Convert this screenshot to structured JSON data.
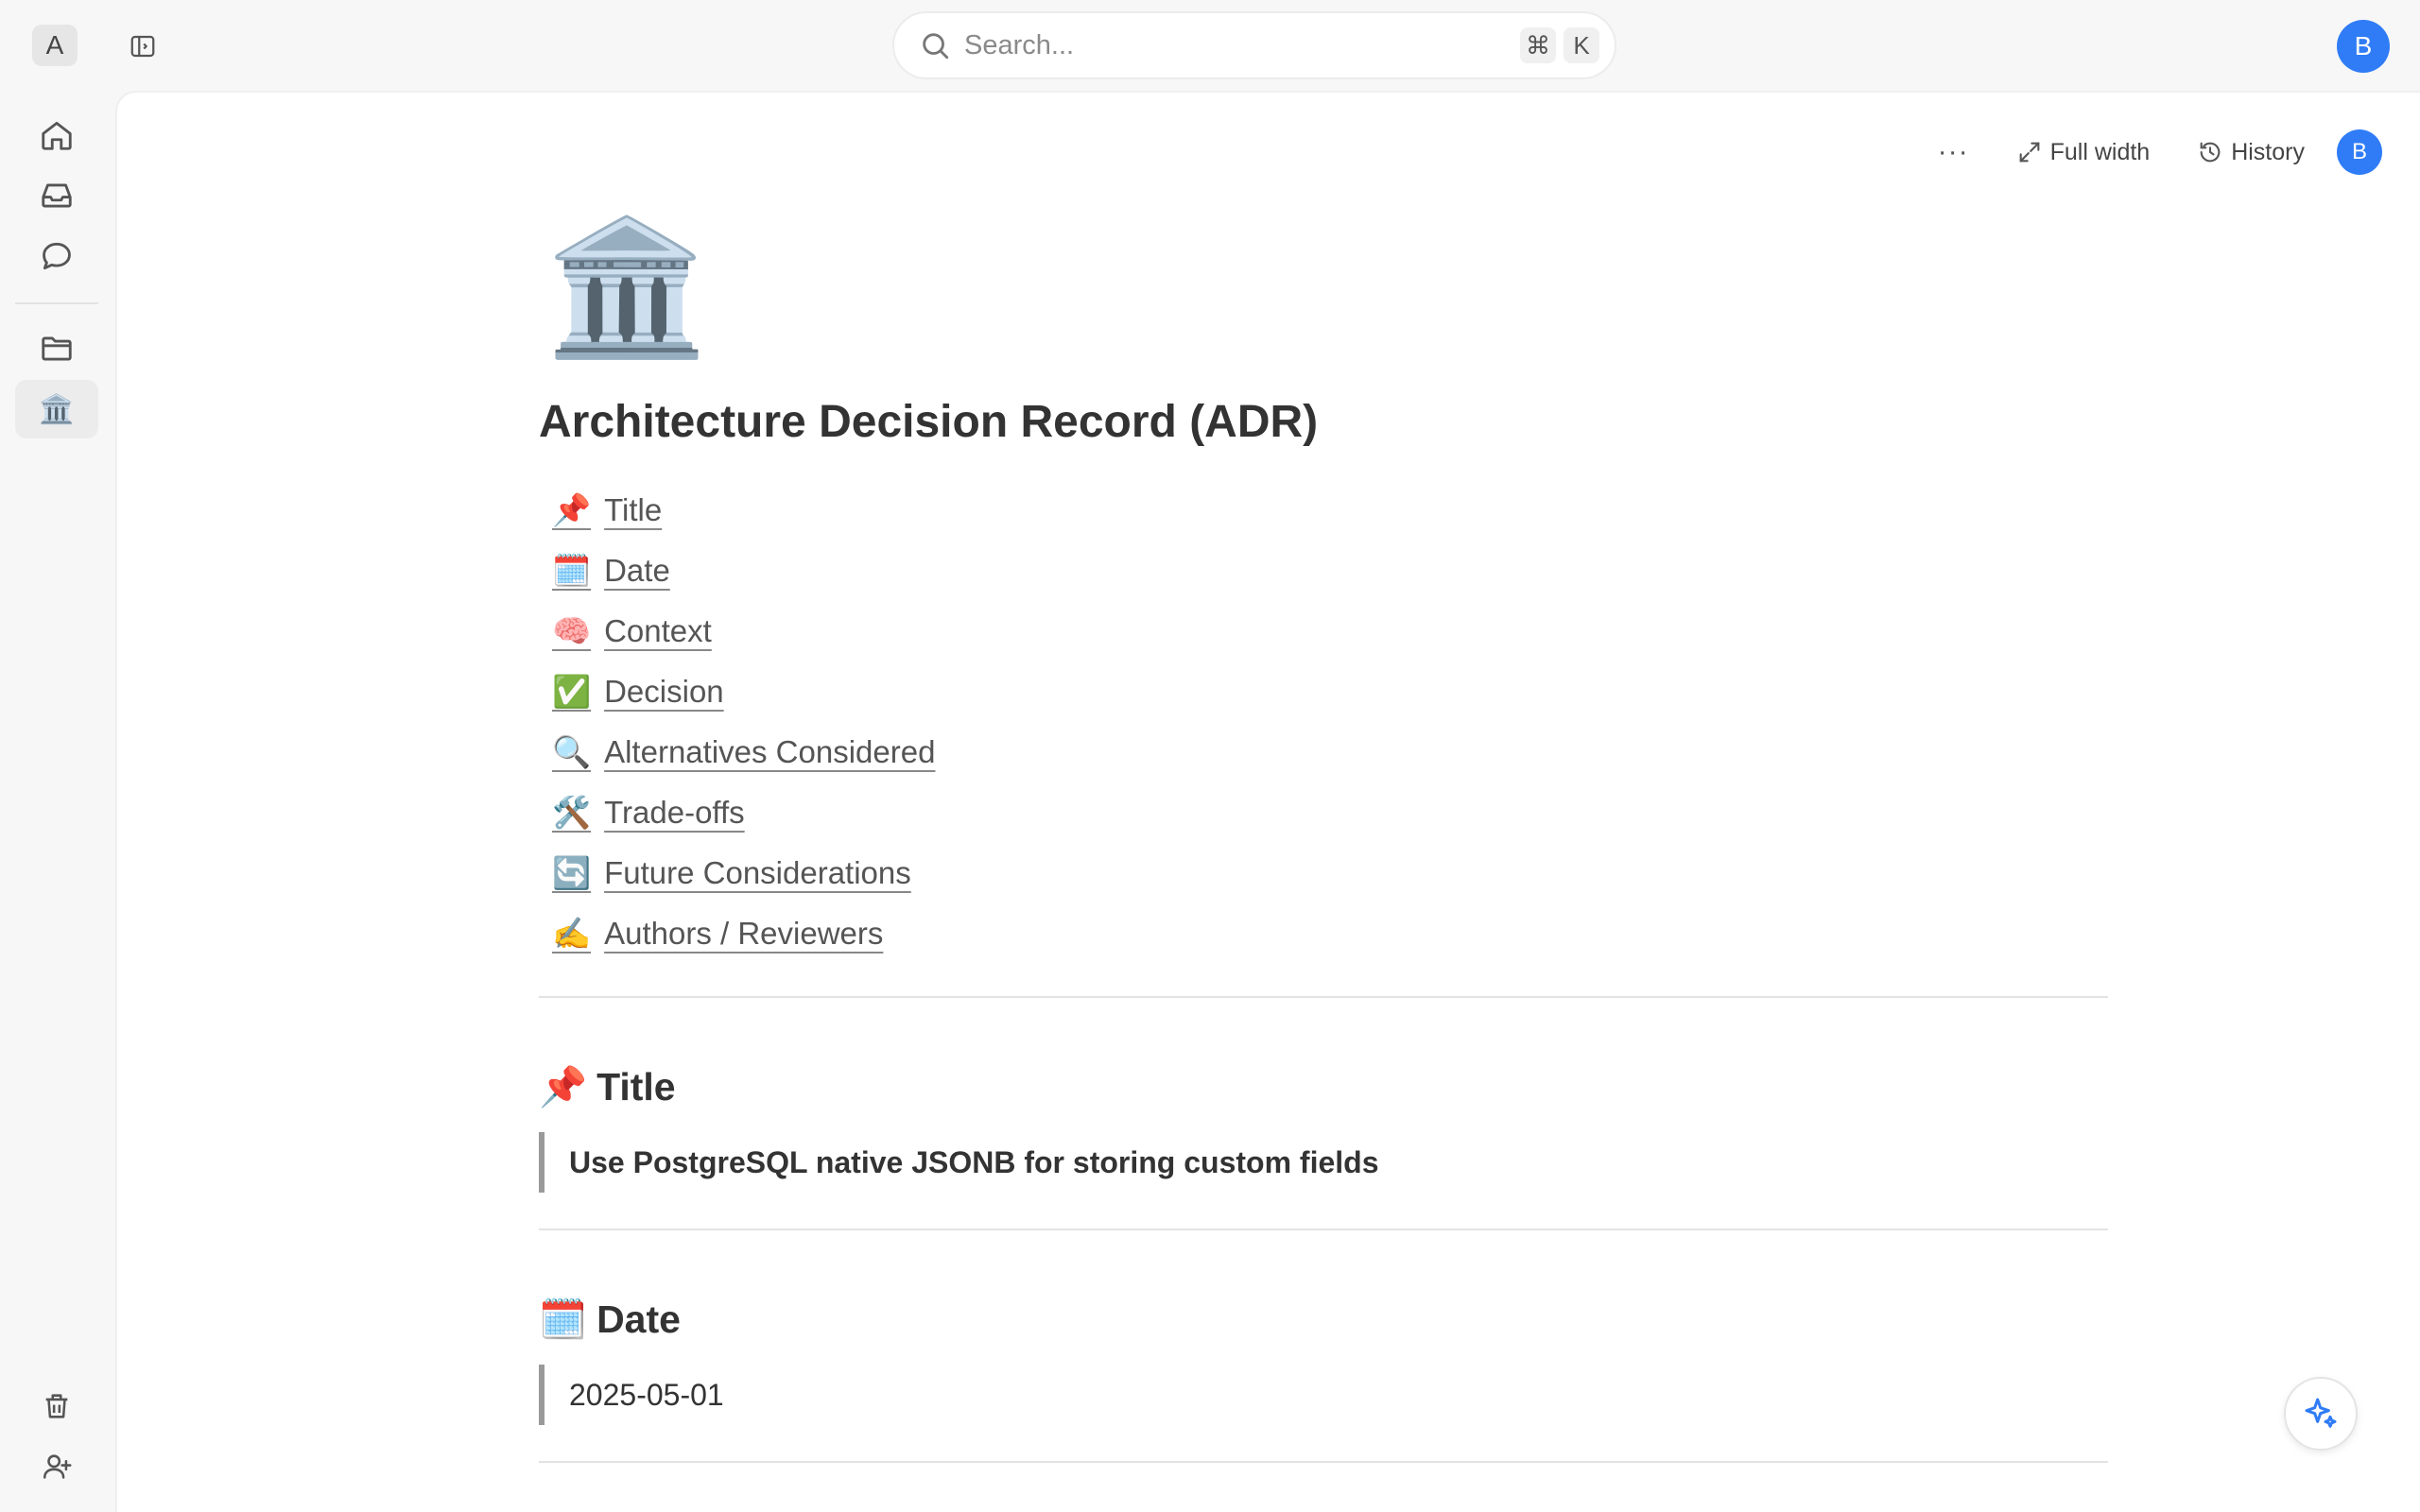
{
  "workspace": {
    "initial": "A"
  },
  "search": {
    "placeholder": "Search...",
    "shortcut_cmd": "⌘",
    "shortcut_key": "K"
  },
  "user": {
    "initial": "B",
    "accent": "#2f7cf6"
  },
  "rail": {
    "items": [
      "home-icon",
      "inbox-icon",
      "chat-icon",
      "folder-icon",
      "page-adr"
    ],
    "active_page_emoji": "🏛️",
    "bottom": [
      "trash-icon",
      "invite-user-icon"
    ]
  },
  "toolbar": {
    "more": "···",
    "full_width": "Full width",
    "history": "History"
  },
  "doc": {
    "emoji": "🏛️",
    "title": "Architecture Decision Record (ADR)",
    "toc": [
      {
        "emoji": "📌",
        "label": "Title"
      },
      {
        "emoji": "🗓️",
        "label": "Date"
      },
      {
        "emoji": "🧠",
        "label": "Context"
      },
      {
        "emoji": "✅",
        "label": "Decision"
      },
      {
        "emoji": "🔍",
        "label": "Alternatives Considered"
      },
      {
        "emoji": "🛠️",
        "label": "Trade-offs"
      },
      {
        "emoji": "🔄",
        "label": "Future Considerations"
      },
      {
        "emoji": "✍️",
        "label": "Authors / Reviewers"
      }
    ],
    "sections": [
      {
        "emoji": "📌",
        "heading": "Title",
        "value": "Use PostgreSQL native JSONB for storing custom fields"
      },
      {
        "emoji": "🗓️",
        "heading": "Date",
        "value": "2025-05-01"
      }
    ]
  }
}
